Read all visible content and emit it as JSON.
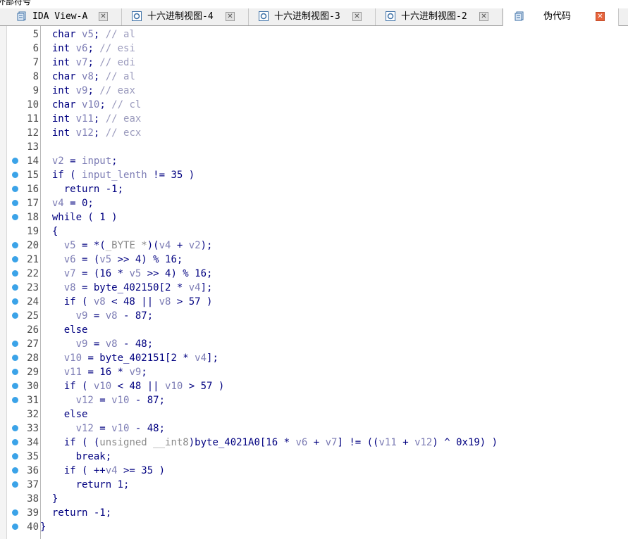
{
  "top_text": "外部符号",
  "tabs": [
    {
      "label": "IDA View-A",
      "icon": "ida-view-icon",
      "active": false
    },
    {
      "label": "十六进制视图-4",
      "icon": "hex-view-icon",
      "active": false
    },
    {
      "label": "十六进制视图-3",
      "icon": "hex-view-icon",
      "active": false
    },
    {
      "label": "十六进制视图-2",
      "icon": "hex-view-icon",
      "active": false
    },
    {
      "label": "伪代码",
      "icon": "pseudocode-icon",
      "active": true
    }
  ],
  "code_lines": [
    {
      "n": "5",
      "bp": false,
      "parts": [
        [
          "",
          "  char "
        ],
        [
          "v",
          "v5"
        ],
        [
          "",
          "; "
        ],
        [
          "c",
          "// al"
        ]
      ]
    },
    {
      "n": "6",
      "bp": false,
      "parts": [
        [
          "",
          "  int "
        ],
        [
          "v",
          "v6"
        ],
        [
          "",
          "; "
        ],
        [
          "c",
          "// esi"
        ]
      ]
    },
    {
      "n": "7",
      "bp": false,
      "parts": [
        [
          "",
          "  int "
        ],
        [
          "v",
          "v7"
        ],
        [
          "",
          "; "
        ],
        [
          "c",
          "// edi"
        ]
      ]
    },
    {
      "n": "8",
      "bp": false,
      "parts": [
        [
          "",
          "  char "
        ],
        [
          "v",
          "v8"
        ],
        [
          "",
          "; "
        ],
        [
          "c",
          "// al"
        ]
      ]
    },
    {
      "n": "9",
      "bp": false,
      "parts": [
        [
          "",
          "  int "
        ],
        [
          "v",
          "v9"
        ],
        [
          "",
          "; "
        ],
        [
          "c",
          "// eax"
        ]
      ]
    },
    {
      "n": "10",
      "bp": false,
      "parts": [
        [
          "",
          "  char "
        ],
        [
          "v",
          "v10"
        ],
        [
          "",
          "; "
        ],
        [
          "c",
          "// cl"
        ]
      ]
    },
    {
      "n": "11",
      "bp": false,
      "parts": [
        [
          "",
          "  int "
        ],
        [
          "v",
          "v11"
        ],
        [
          "",
          "; "
        ],
        [
          "c",
          "// eax"
        ]
      ]
    },
    {
      "n": "12",
      "bp": false,
      "parts": [
        [
          "",
          "  int "
        ],
        [
          "v",
          "v12"
        ],
        [
          "",
          "; "
        ],
        [
          "c",
          "// ecx"
        ]
      ]
    },
    {
      "n": "13",
      "bp": false,
      "parts": []
    },
    {
      "n": "14",
      "bp": true,
      "parts": [
        [
          "",
          "  "
        ],
        [
          "v",
          "v2"
        ],
        [
          "",
          " = "
        ],
        [
          "v",
          "input"
        ],
        [
          "",
          ";"
        ]
      ]
    },
    {
      "n": "15",
      "bp": true,
      "parts": [
        [
          "",
          "  if ( "
        ],
        [
          "v",
          "input_lenth"
        ],
        [
          "",
          " != 35 )"
        ]
      ]
    },
    {
      "n": "16",
      "bp": true,
      "parts": [
        [
          "",
          "    return -1;"
        ]
      ]
    },
    {
      "n": "17",
      "bp": true,
      "parts": [
        [
          "",
          "  "
        ],
        [
          "v",
          "v4"
        ],
        [
          "",
          " = 0;"
        ]
      ]
    },
    {
      "n": "18",
      "bp": true,
      "parts": [
        [
          "",
          "  while ( 1 )"
        ]
      ]
    },
    {
      "n": "19",
      "bp": false,
      "parts": [
        [
          "",
          "  {"
        ]
      ]
    },
    {
      "n": "20",
      "bp": true,
      "parts": [
        [
          "",
          "    "
        ],
        [
          "v",
          "v5"
        ],
        [
          "",
          " = *("
        ],
        [
          "g",
          "_BYTE *"
        ],
        [
          "",
          ")("
        ],
        [
          "v",
          "v4"
        ],
        [
          "",
          " + "
        ],
        [
          "v",
          "v2"
        ],
        [
          "",
          ");"
        ]
      ]
    },
    {
      "n": "21",
      "bp": true,
      "parts": [
        [
          "",
          "    "
        ],
        [
          "v",
          "v6"
        ],
        [
          "",
          " = ("
        ],
        [
          "v",
          "v5"
        ],
        [
          "",
          " >> 4) % 16;"
        ]
      ]
    },
    {
      "n": "22",
      "bp": true,
      "parts": [
        [
          "",
          "    "
        ],
        [
          "v",
          "v7"
        ],
        [
          "",
          " = (16 * "
        ],
        [
          "v",
          "v5"
        ],
        [
          "",
          " >> 4) % 16;"
        ]
      ]
    },
    {
      "n": "23",
      "bp": true,
      "parts": [
        [
          "",
          "    "
        ],
        [
          "v",
          "v8"
        ],
        [
          "",
          " = byte_402150[2 * "
        ],
        [
          "v",
          "v4"
        ],
        [
          "",
          "];"
        ]
      ]
    },
    {
      "n": "24",
      "bp": true,
      "parts": [
        [
          "",
          "    if ( "
        ],
        [
          "v",
          "v8"
        ],
        [
          "",
          " < 48 || "
        ],
        [
          "v",
          "v8"
        ],
        [
          "",
          " > 57 )"
        ]
      ]
    },
    {
      "n": "25",
      "bp": true,
      "parts": [
        [
          "",
          "      "
        ],
        [
          "v",
          "v9"
        ],
        [
          "",
          " = "
        ],
        [
          "v",
          "v8"
        ],
        [
          "",
          " - 87;"
        ]
      ]
    },
    {
      "n": "26",
      "bp": false,
      "parts": [
        [
          "",
          "    else"
        ]
      ]
    },
    {
      "n": "27",
      "bp": true,
      "parts": [
        [
          "",
          "      "
        ],
        [
          "v",
          "v9"
        ],
        [
          "",
          " = "
        ],
        [
          "v",
          "v8"
        ],
        [
          "",
          " - 48;"
        ]
      ]
    },
    {
      "n": "28",
      "bp": true,
      "parts": [
        [
          "",
          "    "
        ],
        [
          "v",
          "v10"
        ],
        [
          "",
          " = byte_402151[2 * "
        ],
        [
          "v",
          "v4"
        ],
        [
          "",
          "];"
        ]
      ]
    },
    {
      "n": "29",
      "bp": true,
      "parts": [
        [
          "",
          "    "
        ],
        [
          "v",
          "v11"
        ],
        [
          "",
          " = 16 * "
        ],
        [
          "v",
          "v9"
        ],
        [
          "",
          ";"
        ]
      ]
    },
    {
      "n": "30",
      "bp": true,
      "parts": [
        [
          "",
          "    if ( "
        ],
        [
          "v",
          "v10"
        ],
        [
          "",
          " < 48 || "
        ],
        [
          "v",
          "v10"
        ],
        [
          "",
          " > 57 )"
        ]
      ]
    },
    {
      "n": "31",
      "bp": true,
      "parts": [
        [
          "",
          "      "
        ],
        [
          "v",
          "v12"
        ],
        [
          "",
          " = "
        ],
        [
          "v",
          "v10"
        ],
        [
          "",
          " - 87;"
        ]
      ]
    },
    {
      "n": "32",
      "bp": false,
      "parts": [
        [
          "",
          "    else"
        ]
      ]
    },
    {
      "n": "33",
      "bp": true,
      "parts": [
        [
          "",
          "      "
        ],
        [
          "v",
          "v12"
        ],
        [
          "",
          " = "
        ],
        [
          "v",
          "v10"
        ],
        [
          "",
          " - 48;"
        ]
      ]
    },
    {
      "n": "34",
      "bp": true,
      "parts": [
        [
          "",
          "    if ( ("
        ],
        [
          "g",
          "unsigned __int8"
        ],
        [
          "",
          ")byte_4021A0[16 * "
        ],
        [
          "v",
          "v6"
        ],
        [
          "",
          " + "
        ],
        [
          "v",
          "v7"
        ],
        [
          "",
          "] != (("
        ],
        [
          "v",
          "v11"
        ],
        [
          "",
          " + "
        ],
        [
          "v",
          "v12"
        ],
        [
          "",
          ") ^ 0x19) )"
        ]
      ]
    },
    {
      "n": "35",
      "bp": true,
      "parts": [
        [
          "",
          "      break;"
        ]
      ]
    },
    {
      "n": "36",
      "bp": true,
      "parts": [
        [
          "",
          "    if ( ++"
        ],
        [
          "v",
          "v4"
        ],
        [
          "",
          " >= 35 )"
        ]
      ]
    },
    {
      "n": "37",
      "bp": true,
      "parts": [
        [
          "",
          "      return 1;"
        ]
      ]
    },
    {
      "n": "38",
      "bp": false,
      "parts": [
        [
          "",
          "  }"
        ]
      ]
    },
    {
      "n": "39",
      "bp": true,
      "parts": [
        [
          "",
          "  return -1;"
        ]
      ]
    },
    {
      "n": "40",
      "bp": true,
      "parts": [
        [
          "",
          "}"
        ]
      ]
    }
  ]
}
